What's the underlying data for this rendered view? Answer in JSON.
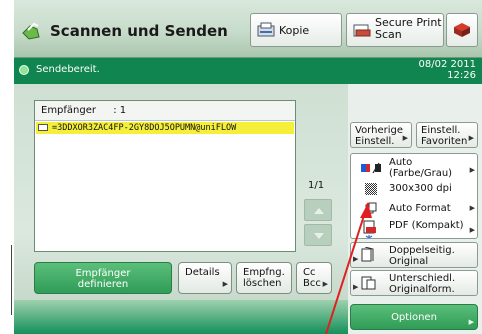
{
  "app": {
    "title": "Scannen und Senden"
  },
  "topbar": {
    "kopie_label": "Kopie",
    "secure_line1": "Secure Print",
    "secure_line2": "Scan"
  },
  "status": {
    "text": "Sendebereit.",
    "date": "08/02 2011",
    "time": "12:26"
  },
  "recipients": {
    "header_label": "Empfänger",
    "header_count": ": 1",
    "items": [
      {
        "address": "=3DDXOR3ZAC4FP-2GY8DOJ5OPUMN@uniFLOW"
      }
    ]
  },
  "pagination": {
    "indicator": "1/1"
  },
  "bottom_buttons": {
    "empf_def_line1": "Empfänger",
    "empf_def_line2": "definieren",
    "details": "Details",
    "empfng_line1": "Empfng.",
    "empfng_line2": "löschen",
    "cc_line1": "Cc",
    "cc_line2": "Bcc"
  },
  "right_panel": {
    "vorherige_line1": "Vorherige",
    "vorherige_line2": "Einstell.",
    "favoriten_line1": "Einstell.",
    "favoriten_line2": "Favoriten",
    "color_line1": "Auto",
    "color_line2": "(Farbe/Grau)",
    "resolution": "300x300 dpi",
    "format": "Auto Format",
    "file_type": "PDF (Kompakt)",
    "duplex_line1": "Doppelseitig.",
    "duplex_line2": "Original",
    "mixed_line1": "Unterschiedl.",
    "mixed_line2": "Originalform.",
    "options": "Optionen"
  },
  "colors": {
    "accent_green": "#2f9c57",
    "status_bar": "#11854f",
    "highlight_row": "#f5ef3a",
    "annotation_red": "#e02020"
  },
  "icons": {
    "app": "scan-send-icon",
    "kopie": "copy-icon",
    "secure": "secure-print-scan-icon",
    "menu": "main-menu-icon",
    "status": "ready-status-icon",
    "recipient": "email-recipient-icon",
    "color": "color-mode-icon",
    "resolution": "resolution-icon",
    "format": "scan-size-icon",
    "file_type": "pdf-file-icon",
    "duplex": "duplex-original-icon",
    "mixed": "mixed-size-original-icon"
  }
}
